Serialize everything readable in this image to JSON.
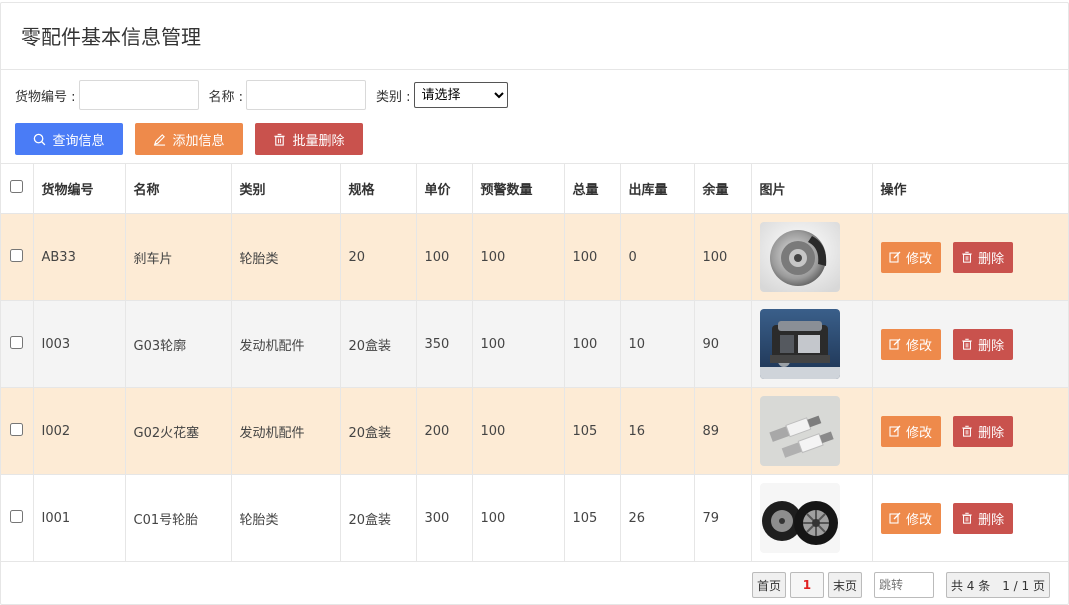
{
  "page_title": "零配件基本信息管理",
  "filters": {
    "code_label": "货物编号 :",
    "code_value": "",
    "name_label": "名称 :",
    "name_value": "",
    "category_label": "类别 :",
    "category_selected": "请选择"
  },
  "buttons": {
    "query": "查询信息",
    "add": "添加信息",
    "batch_delete": "批量删除"
  },
  "table": {
    "headers": [
      "货物编号",
      "名称",
      "类别",
      "规格",
      "单价",
      "预警数量",
      "总量",
      "出库量",
      "余量",
      "图片",
      "操作"
    ],
    "rows": [
      {
        "code": "AB33",
        "name": "刹车片",
        "category": "轮胎类",
        "spec": "20",
        "price": "100",
        "warning": "100",
        "total": "100",
        "out": "0",
        "remain": "100",
        "image": "brake-disc"
      },
      {
        "code": "I003",
        "name": "G03轮廓",
        "category": "发动机配件",
        "spec": "20盒装",
        "price": "350",
        "warning": "100",
        "total": "100",
        "out": "10",
        "remain": "90",
        "image": "engine"
      },
      {
        "code": "I002",
        "name": "G02火花塞",
        "category": "发动机配件",
        "spec": "20盒装",
        "price": "200",
        "warning": "100",
        "total": "105",
        "out": "16",
        "remain": "89",
        "image": "spark-plugs"
      },
      {
        "code": "I001",
        "name": "C01号轮胎",
        "category": "轮胎类",
        "spec": "20盒装",
        "price": "300",
        "warning": "100",
        "total": "105",
        "out": "26",
        "remain": "79",
        "image": "tires"
      }
    ],
    "edit_label": "修改",
    "delete_label": "删除"
  },
  "pagination": {
    "first": "首页",
    "current": "1",
    "last": "末页",
    "jump_placeholder": "跳转",
    "info": "共 4 条　1 / 1 页"
  },
  "colors": {
    "primary": "#4a7cf6",
    "warning": "#ee8a4b",
    "danger": "#c9524d",
    "row_highlight": "#fdebd5"
  }
}
